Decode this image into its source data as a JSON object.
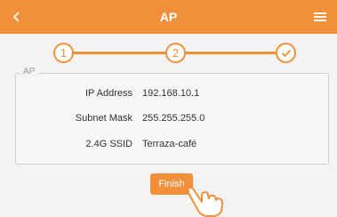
{
  "header": {
    "title": "AP",
    "back_icon": "chevron-left-icon",
    "menu_icon": "hamburger-menu-icon"
  },
  "stepper": {
    "steps": [
      {
        "label": "1",
        "state": "done"
      },
      {
        "label": "2",
        "state": "done"
      },
      {
        "label": "",
        "state": "complete",
        "icon": "check-icon"
      }
    ]
  },
  "panel": {
    "legend": "AP",
    "rows": [
      {
        "label": "IP Address",
        "value": "192.168.10.1"
      },
      {
        "label": "Subnet Mask",
        "value": "255.255.255.0"
      },
      {
        "label": "2.4G SSID",
        "value": "Terraza-café"
      }
    ]
  },
  "finish_button": {
    "label": "Finish"
  },
  "colors": {
    "accent": "#f2903a",
    "background": "#f3f3f3"
  },
  "pointer_icon": "hand-pointer-icon"
}
